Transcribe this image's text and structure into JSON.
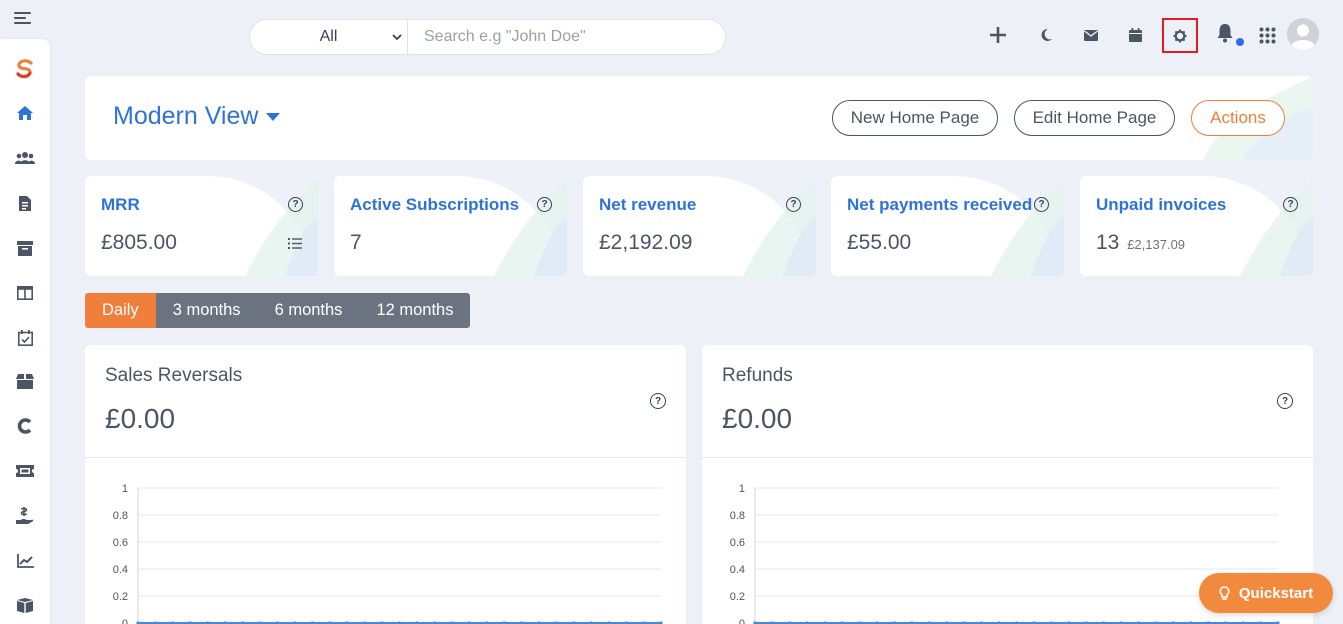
{
  "search": {
    "scope_value": "All",
    "placeholder": "Search e.g \"John Doe\""
  },
  "header": {
    "view_title": "Modern View",
    "buttons": {
      "new_home_page": "New Home Page",
      "edit_home_page": "Edit Home Page",
      "actions": "Actions"
    }
  },
  "stats": [
    {
      "title": "MRR",
      "value": "£805.00",
      "sub": ""
    },
    {
      "title": "Active Subscriptions",
      "value": "7",
      "sub": ""
    },
    {
      "title": "Net revenue",
      "value": "£2,192.09",
      "sub": ""
    },
    {
      "title": "Net payments received",
      "value": "£55.00",
      "sub": ""
    },
    {
      "title": "Unpaid invoices",
      "value": "13",
      "sub": "£2,137.09"
    }
  ],
  "period_tabs": {
    "active": "Daily",
    "labels": [
      "Daily",
      "3 months",
      "6 months",
      "12 months"
    ]
  },
  "charts": [
    {
      "title": "Sales Reversals",
      "value": "£0.00"
    },
    {
      "title": "Refunds",
      "value": "£0.00"
    }
  ],
  "chart_data": [
    {
      "type": "line",
      "y_ticks": [
        "1",
        "0.8",
        "0.6",
        "0.4",
        "0.2",
        "0"
      ],
      "ylim": [
        0,
        1
      ],
      "grid": true,
      "series": [
        {
          "values": [
            0,
            0,
            0,
            0,
            0,
            0,
            0,
            0,
            0,
            0,
            0,
            0,
            0,
            0,
            0,
            0,
            0,
            0,
            0,
            0,
            0,
            0,
            0,
            0,
            0,
            0,
            0,
            0,
            0,
            0,
            0
          ]
        }
      ]
    },
    {
      "type": "line",
      "y_ticks": [
        "1",
        "0.8",
        "0.6",
        "0.4",
        "0.2",
        "0"
      ],
      "ylim": [
        0,
        1
      ],
      "grid": true,
      "series": [
        {
          "values": [
            0,
            0,
            0,
            0,
            0,
            0,
            0,
            0,
            0,
            0,
            0,
            0,
            0,
            0,
            0,
            0,
            0,
            0,
            0,
            0,
            0,
            0,
            0,
            0,
            0,
            0,
            0,
            0,
            0,
            0,
            0
          ]
        }
      ]
    }
  ],
  "quickstart": {
    "label": "Quickstart"
  },
  "colors": {
    "accent_blue": "#2f73d9",
    "accent_orange": "#f07f3c",
    "tab_gray": "#6b7380",
    "notification_dot": "#2f6fe0",
    "highlight_red": "#e01b24"
  },
  "icons": {
    "sidebar": [
      "logo-icon",
      "home-icon",
      "users-icon",
      "invoice-icon",
      "archive-icon",
      "columns-icon",
      "calendar-check-icon",
      "box-icon",
      "c-icon",
      "ticket-icon",
      "money-hand-icon",
      "chart-line-icon",
      "boxes-icon"
    ],
    "topbar": [
      "plus-icon",
      "moon-icon",
      "mail-icon",
      "calendar-icon",
      "gear-icon",
      "bell-icon",
      "apps-grid-icon",
      "user-avatar-icon"
    ]
  }
}
